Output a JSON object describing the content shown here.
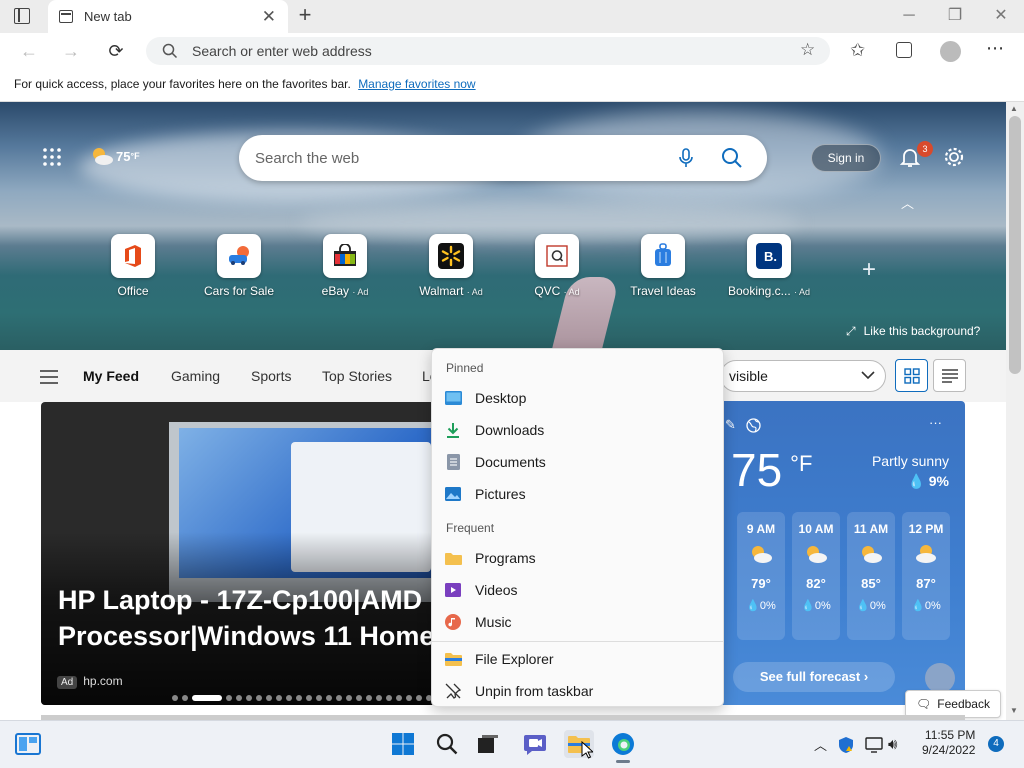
{
  "browser": {
    "tab_title": "New tab",
    "address_placeholder": "Search or enter web address",
    "favbar_text": "For quick access, place your favorites here on the favorites bar.",
    "favbar_link": "Manage favorites now"
  },
  "newtab": {
    "weather_temp": "75",
    "weather_unit": "°F",
    "search_placeholder": "Search the web",
    "sign_in": "Sign in",
    "notification_count": "3",
    "like_background": "Like this background?",
    "quick_links": [
      {
        "label": "Office",
        "ad": ""
      },
      {
        "label": "Cars for Sale",
        "ad": ""
      },
      {
        "label": "eBay",
        "ad": "· Ad"
      },
      {
        "label": "Walmart",
        "ad": "· Ad"
      },
      {
        "label": "QVC",
        "ad": "· Ad"
      },
      {
        "label": "Travel Ideas",
        "ad": ""
      },
      {
        "label": "Booking.c...",
        "ad": "· Ad"
      }
    ],
    "feed_tabs": [
      "My Feed",
      "Gaming",
      "Sports",
      "Top Stories",
      "Le"
    ],
    "layout_select": "visible"
  },
  "card": {
    "headline_line1": "HP Laptop - 17Z-Cp100|AMD",
    "headline_line2": "Processor|Windows 11 Home|",
    "ad_label": "Ad",
    "source": "hp.com"
  },
  "weather": {
    "temp": "75",
    "unit": "°F",
    "condition": "Partly sunny",
    "precip": "9%",
    "more": "···",
    "hours": [
      {
        "time": "9 AM",
        "temp": "79°",
        "precip": "0%"
      },
      {
        "time": "10 AM",
        "temp": "82°",
        "precip": "0%"
      },
      {
        "time": "11 AM",
        "temp": "85°",
        "precip": "0%"
      },
      {
        "time": "12 PM",
        "temp": "87°",
        "precip": "0%"
      }
    ],
    "forecast_button": "See full forecast ›"
  },
  "jumplist": {
    "pinned_header": "Pinned",
    "pinned": [
      "Desktop",
      "Downloads",
      "Documents",
      "Pictures"
    ],
    "frequent_header": "Frequent",
    "frequent": [
      "Programs",
      "Videos",
      "Music"
    ],
    "actions": [
      "File Explorer",
      "Unpin from taskbar"
    ]
  },
  "feedback": "Feedback",
  "taskbar": {
    "time": "11:55 PM",
    "date": "9/24/2022",
    "notification_count": "4"
  },
  "colors": {
    "accent": "#0f6cbd",
    "weather_bg": "#3f7fd0",
    "badge": "#d84a2c"
  }
}
